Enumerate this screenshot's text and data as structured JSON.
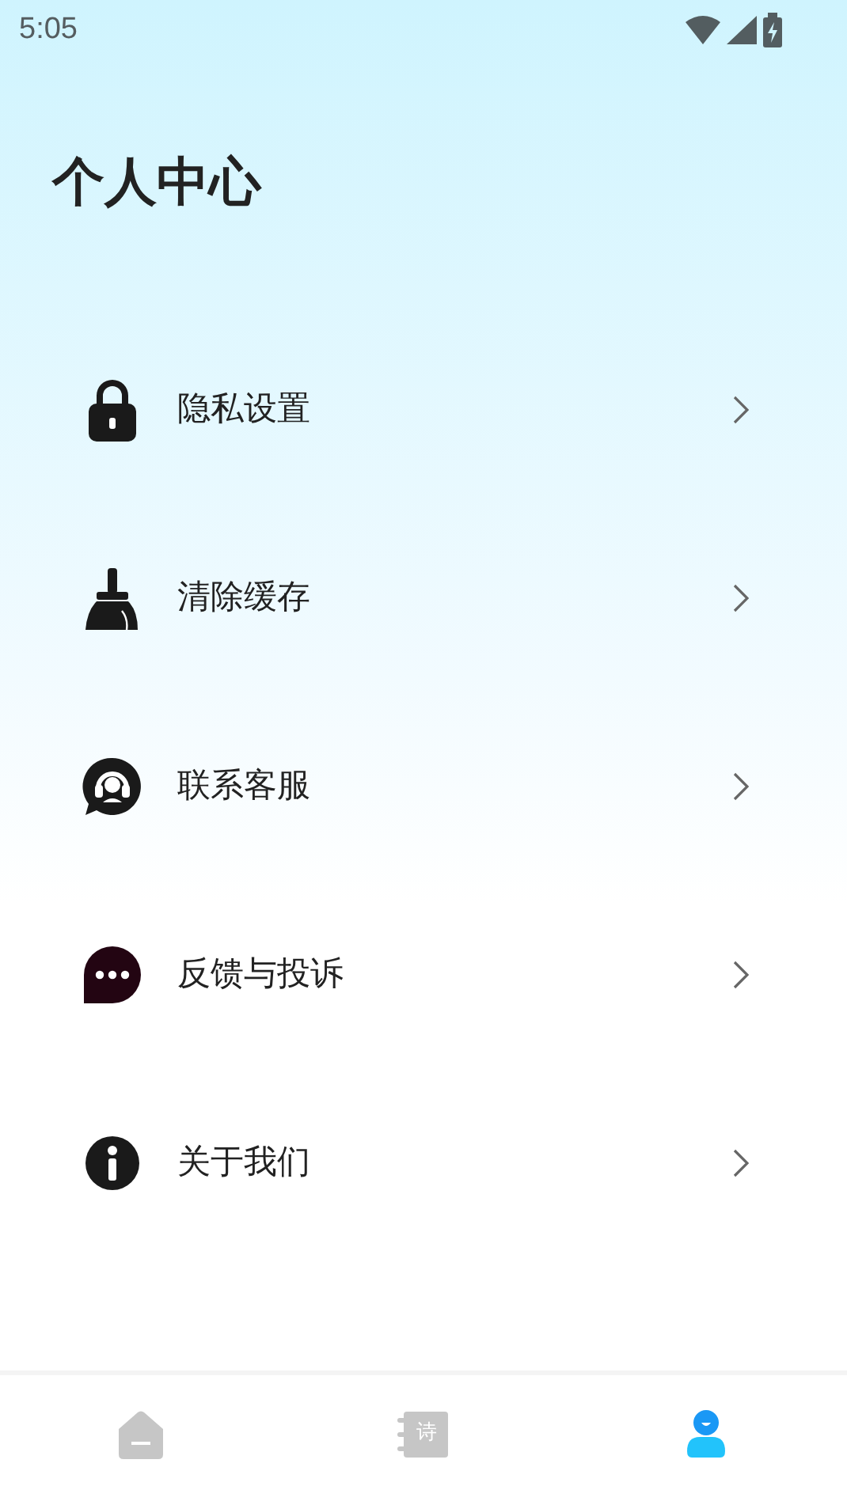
{
  "status_bar": {
    "time": "5:05"
  },
  "header": {
    "title": "个人中心"
  },
  "menu": [
    {
      "kind": "lock",
      "label": "隐私设置"
    },
    {
      "kind": "broom",
      "label": "清除缓存"
    },
    {
      "kind": "headset",
      "label": "联系客服"
    },
    {
      "kind": "chat",
      "label": "反馈与投诉"
    },
    {
      "kind": "info",
      "label": "关于我们"
    }
  ],
  "bottom_nav": [
    {
      "kind": "home",
      "selected": false
    },
    {
      "kind": "poems",
      "icon_text": "诗",
      "selected": false
    },
    {
      "kind": "profile",
      "selected": true
    }
  ]
}
